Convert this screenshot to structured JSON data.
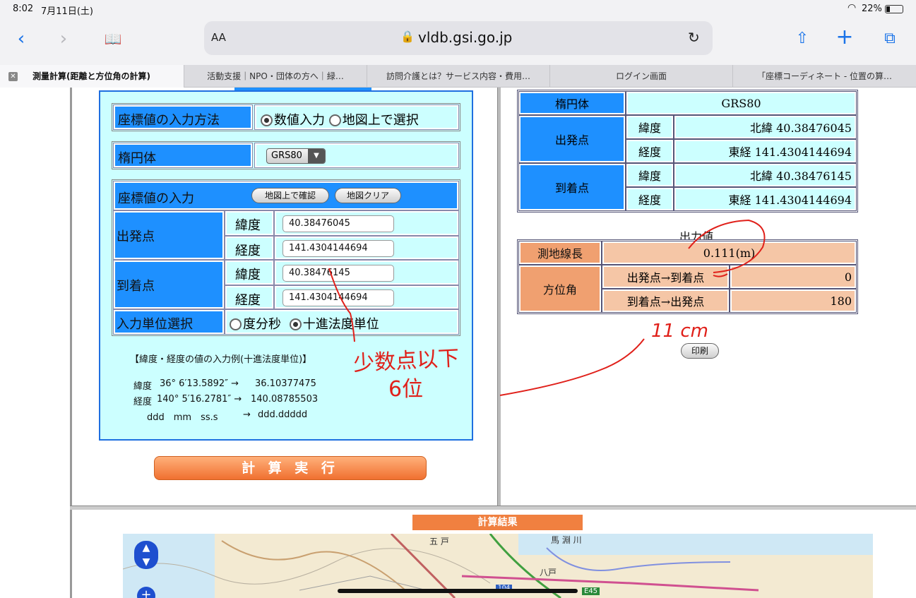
{
  "status": {
    "time": "8:02",
    "date": "7月11日(土)",
    "battery": "22%"
  },
  "browser": {
    "url": "vldb.gsi.go.jp",
    "aa": "AA",
    "tabs": [
      "測量計算(距離と方位角の計算)",
      "活動支援｜NPO・団体の方へ｜緑…",
      "訪問介護とは？サービス内容・費用…",
      "ログイン画面",
      "「座標コーディネート - 位置の算…"
    ]
  },
  "form": {
    "input_method_label": "座標値の入力方法",
    "input_method_opt1": "数値入力",
    "input_method_opt2": "地図上で選択",
    "ellipsoid_label": "楕円体",
    "ellipsoid_value": "GRS80",
    "coord_input_label": "座標値の入力",
    "confirm_btn": "地図上で確認",
    "clear_btn": "地図クリア",
    "start_label": "出発点",
    "end_label": "到着点",
    "lat_label": "緯度",
    "lon_label": "経度",
    "start_lat": "40.38476045",
    "start_lon": "141.4304144694",
    "end_lat": "40.38476145",
    "end_lon": "141.4304144694",
    "unit_label": "入力単位選択",
    "unit_opt1": "度分秒",
    "unit_opt2": "十進法度単位",
    "example_title": "【緯度・経度の値の入力例(十進法度単位)】",
    "ex_lat_label": "緯度",
    "ex_lat_dms": "36° 6′13.5892″ →",
    "ex_lat_dec": "36.10377475",
    "ex_lon_label": "経度",
    "ex_lon_dms": "140° 5′16.2781″ →",
    "ex_lon_dec": "140.08785503",
    "ex_fmt_dms": "ddd　mm　ss.s",
    "ex_fmt_arrow": "→",
    "ex_fmt_dec": "ddd.ddddd",
    "calc_btn": "計 算 実 行"
  },
  "result": {
    "ellipsoid_label": "楕円体",
    "ellipsoid_value": "GRS80",
    "start_label": "出発点",
    "end_label": "到着点",
    "lat_label": "緯度",
    "lon_label": "経度",
    "start_lat": "北緯 40.38476045",
    "start_lon": "東経 141.4304144694",
    "end_lat": "北緯 40.38476145",
    "end_lon": "東経 141.4304144694",
    "output_title": "出力値",
    "distance_label": "測地線長",
    "distance_value": "0.111(m)",
    "azimuth_label": "方位角",
    "az1_label": "出発点→到着点",
    "az1_value": "0",
    "az2_label": "到着点→出発点",
    "az2_value": "180",
    "print_btn": "印刷"
  },
  "annotations": {
    "note1": "少数点以下",
    "note2": "6位",
    "note3": "11 cm"
  },
  "map": {
    "header": "計算結果",
    "labels": [
      "五 戸",
      "馬 淵 川",
      "八戸",
      "E45",
      "104"
    ]
  },
  "colors": {
    "blue": "#1e90ff",
    "cyan": "#ccffff",
    "orange": "#f08040",
    "red_ink": "#e0201a"
  }
}
